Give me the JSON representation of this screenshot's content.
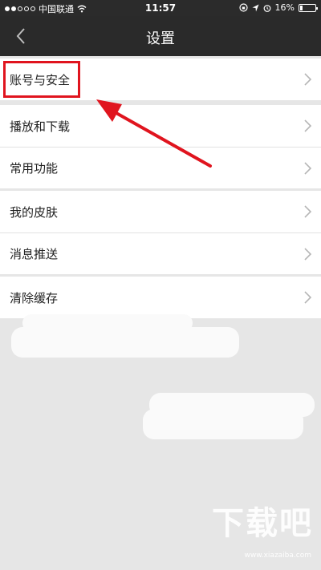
{
  "status_bar": {
    "carrier": "中国联通",
    "time": "11:57",
    "battery": "16%",
    "battery_level": 0.16
  },
  "nav": {
    "title": "设置",
    "back_icon": "chevron-left-icon"
  },
  "settings": {
    "group1": [
      "账号与安全"
    ],
    "group2": [
      "播放和下载",
      "常用功能"
    ],
    "group3": [
      "我的皮肤",
      "消息推送"
    ],
    "group4": [
      "清除缓存"
    ]
  },
  "watermark": {
    "logo_text": "下载吧",
    "url": "www.xiazaiba.com"
  },
  "colors": {
    "highlight": "#e0141e",
    "header": "#2a2a2a",
    "background": "#e6e6e6"
  }
}
